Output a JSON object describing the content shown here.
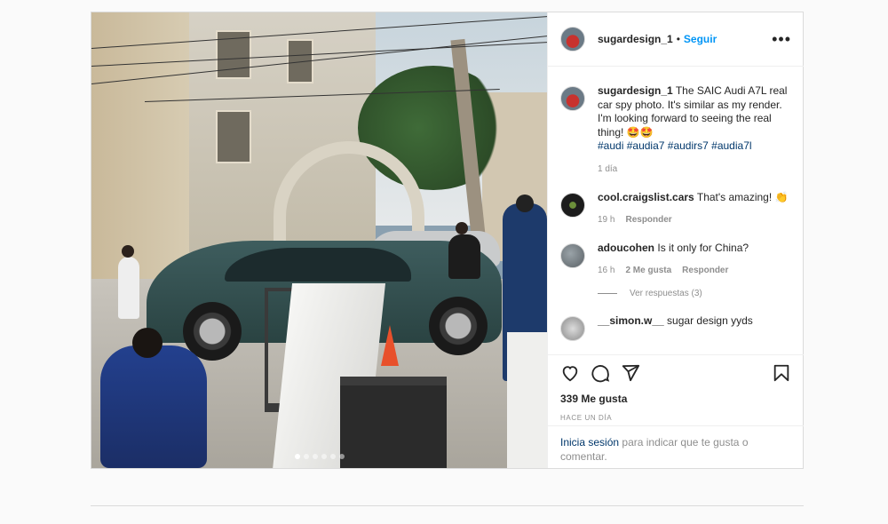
{
  "post": {
    "author": "sugardesign_1",
    "follow_label": "Seguir",
    "separator": "•",
    "more_label": "•••",
    "image_alt": "Audi A7L spy photo",
    "carousel": {
      "count": 6,
      "active": 0
    }
  },
  "caption": {
    "username": "sugardesign_1",
    "text": "The SAIC Audi A7L real car spy photo. It's similar as my render. I'm looking forward to seeing the real thing! 🤩🤩",
    "hashtags": [
      "#audi",
      "#audia7",
      "#audirs7",
      "#audia7l"
    ],
    "time": "1 día"
  },
  "comments": [
    {
      "username": "cool.craigslist.cars",
      "text": "That's amazing! 👏",
      "time": "19 h",
      "likes": "",
      "reply": "Responder"
    },
    {
      "username": "adoucohen",
      "text": "Is it only for China?",
      "time": "16 h",
      "likes": "2 Me gusta",
      "reply": "Responder",
      "view_replies": "Ver respuestas (3)"
    },
    {
      "username": "__simon.w__",
      "text": "sugar design yyds"
    }
  ],
  "actions": {
    "likes": "339 Me gusta",
    "date": "HACE UN DÍA",
    "icons": [
      "heart-icon",
      "comment-icon",
      "share-icon",
      "bookmark-icon"
    ]
  },
  "login": {
    "link": "Inicia sesión",
    "text": "para indicar que te gusta o comentar."
  }
}
